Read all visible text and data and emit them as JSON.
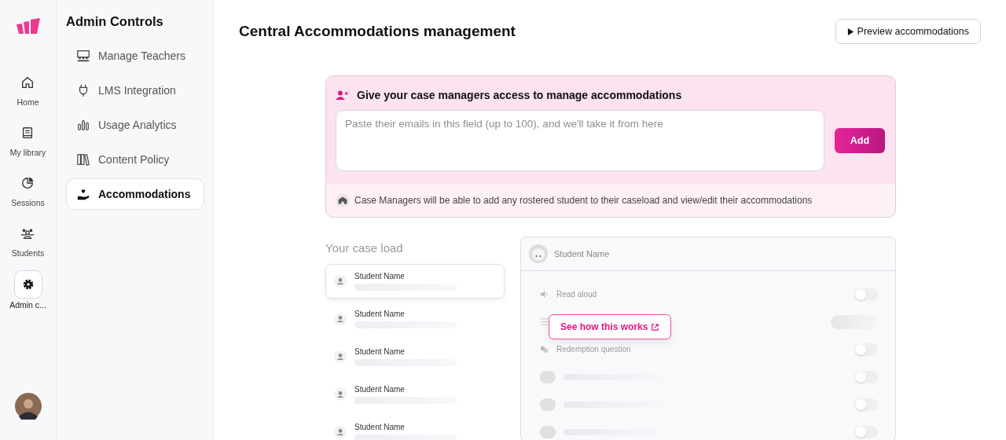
{
  "rail": {
    "items": [
      {
        "label": "Home",
        "selected": false
      },
      {
        "label": "My library",
        "selected": false
      },
      {
        "label": "Sessions",
        "selected": false
      },
      {
        "label": "Students",
        "selected": false
      },
      {
        "label": "Admin c...",
        "selected": true
      }
    ]
  },
  "sidebar": {
    "title": "Admin Controls",
    "items": [
      {
        "label": "Manage Teachers",
        "selected": false
      },
      {
        "label": "LMS Integration",
        "selected": false
      },
      {
        "label": "Usage Analytics",
        "selected": false
      },
      {
        "label": "Content Policy",
        "selected": false
      },
      {
        "label": "Accommodations",
        "selected": true
      }
    ]
  },
  "header": {
    "title": "Central Accommodations management",
    "preview_button": "Preview accommodations"
  },
  "invite_card": {
    "title": "Give your case managers access to manage accommodations",
    "placeholder": "Paste their emails in this field (up to 100), and we'll take it from here",
    "add_button": "Add",
    "note": "Case Managers will be able to add any rostered student to their caseload and view/edit their accommodations"
  },
  "preview": {
    "caseload_title": "Your case load",
    "students": [
      {
        "name": "Student Name",
        "selected": true
      },
      {
        "name": "Student Name",
        "selected": false
      },
      {
        "name": "Student Name",
        "selected": false
      },
      {
        "name": "Student Name",
        "selected": false
      },
      {
        "name": "Student Name",
        "selected": false
      }
    ],
    "detail": {
      "student_name": "Student Name",
      "settings": [
        {
          "kind": "toggle",
          "label": "Read aloud",
          "on": false
        },
        {
          "kind": "covered"
        },
        {
          "kind": "toggle",
          "label": "Redemption question",
          "on": false
        },
        {
          "kind": "blurred",
          "on": false
        },
        {
          "kind": "blurred",
          "on": false
        },
        {
          "kind": "blurred",
          "on": false
        }
      ]
    },
    "tooltip": "See how this works"
  }
}
